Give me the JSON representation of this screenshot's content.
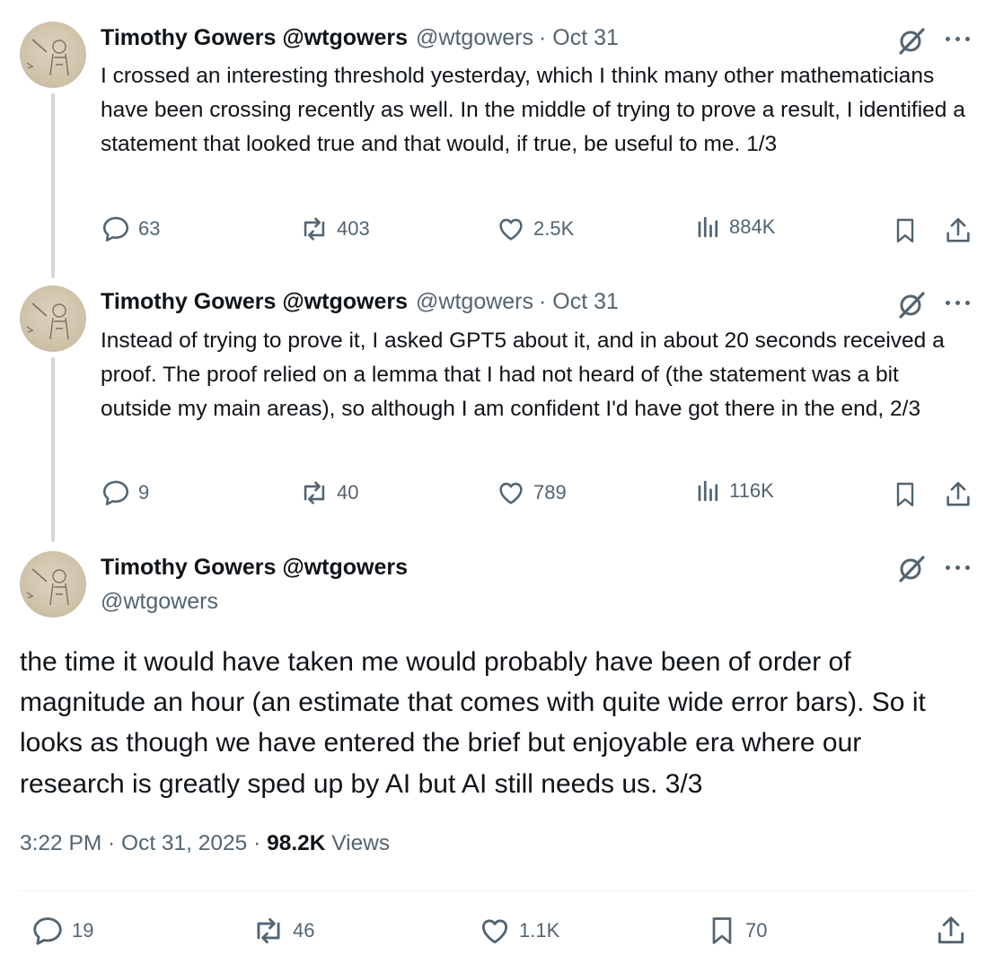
{
  "tweets": [
    {
      "name": "Timothy Gowers @wtgowers",
      "handle": "@wtgowers",
      "date": "· Oct 31",
      "text": "I crossed an interesting threshold yesterday, which I think many other mathematicians have been crossing recently as well. In the middle of trying to prove a result, I identified a statement that looked true and that would, if true, be useful to me. 1/3",
      "replies": "63",
      "reposts": "403",
      "likes": "2.5K",
      "views": "884K"
    },
    {
      "name": "Timothy Gowers @wtgowers",
      "handle": "@wtgowers",
      "date": "· Oct 31",
      "text": "Instead of trying to prove it, I asked GPT5 about it, and in about 20 seconds received a proof. The proof relied on a lemma that I had not heard of (the statement was a bit outside my main areas), so although I am confident I'd have got there in the end, 2/3",
      "replies": "9",
      "reposts": "40",
      "likes": "789",
      "views": "116K"
    }
  ],
  "main_tweet": {
    "name": "Timothy Gowers @wtgowers",
    "handle": "@wtgowers",
    "text": "the time it would have taken me would probably have been of order of magnitude an hour (an estimate that comes with quite wide error bars). So it looks as though we have entered the brief but enjoyable era where our research is greatly sped up by AI but AI still needs us. 3/3",
    "timestamp": "3:22 PM · Oct 31, 2025 · ",
    "views_count": "98.2K",
    "views_label": " Views",
    "replies": "19",
    "reposts": "46",
    "likes": "1.1K",
    "bookmarks": "70"
  },
  "icons": {
    "reply": "speech-bubble-icon",
    "repost": "repost-arrows-icon",
    "like": "heart-icon",
    "views": "bar-chart-icon",
    "bookmark": "bookmark-icon",
    "share": "share-upload-icon",
    "grok": "grok-slash-circle-icon",
    "more": "ellipsis-icon"
  },
  "colors": {
    "text": "#0f1419",
    "secondary": "#536471",
    "thread_line": "#cfd9de",
    "divider": "#eff3f4"
  }
}
